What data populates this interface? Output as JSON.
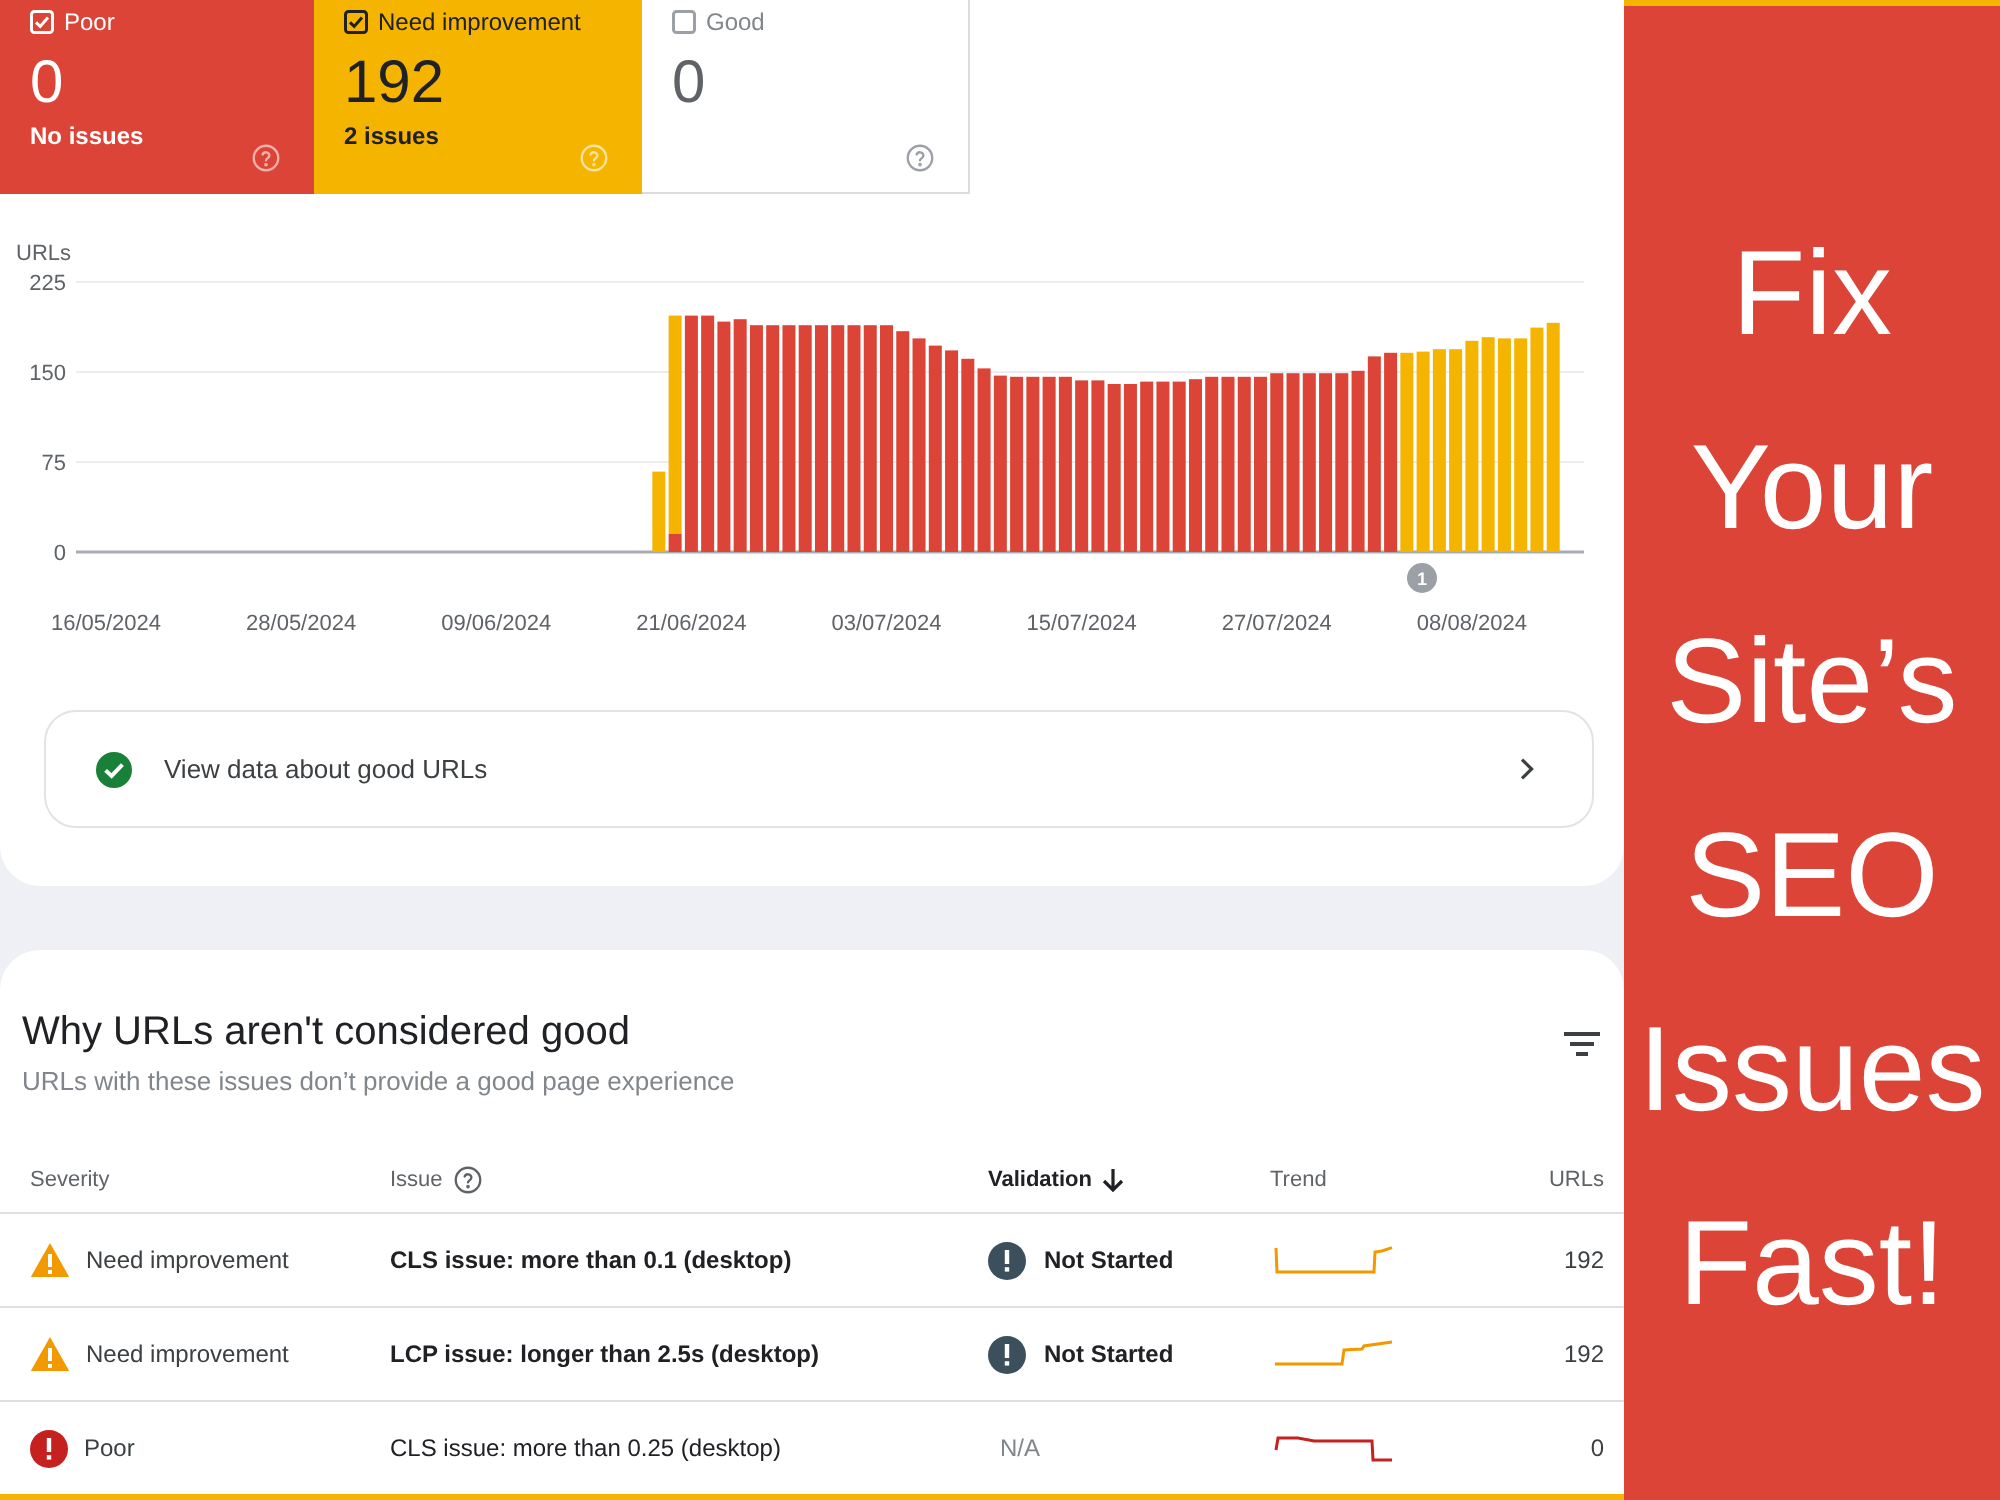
{
  "summary_cards": [
    {
      "label": "Poor",
      "checked": true,
      "color": "#db4437",
      "count": "0",
      "summary": "No issues"
    },
    {
      "label": "Need improvement",
      "checked": true,
      "color": "#f4b400",
      "count": "192",
      "summary": "2 issues"
    },
    {
      "label": "Good",
      "checked": false,
      "count": "0"
    }
  ],
  "chart": {
    "chart_data": {
      "type": "bar",
      "ylabel": "URLs",
      "categories": [
        "16/05/2024",
        null,
        null,
        null,
        null,
        null,
        null,
        null,
        null,
        null,
        null,
        null,
        "28/05/2024",
        null,
        null,
        null,
        null,
        null,
        null,
        null,
        null,
        null,
        null,
        null,
        "09/06/2024",
        null,
        null,
        null,
        null,
        null,
        null,
        null,
        null,
        null,
        null,
        null,
        "21/06/2024",
        null,
        null,
        null,
        null,
        null,
        null,
        null,
        null,
        null,
        null,
        null,
        "03/07/2024",
        null,
        null,
        null,
        null,
        null,
        null,
        null,
        null,
        null,
        null,
        null,
        "15/07/2024",
        null,
        null,
        null,
        null,
        null,
        null,
        null,
        null,
        null,
        null,
        null,
        "27/07/2024",
        null,
        null,
        null,
        null,
        null,
        null,
        null,
        null,
        null,
        null,
        null,
        "08/08/2024",
        null,
        null,
        null,
        null,
        null
      ],
      "series": [
        {
          "color": "#db4437",
          "values": [
            null,
            null,
            null,
            null,
            null,
            null,
            null,
            null,
            null,
            null,
            null,
            null,
            null,
            null,
            null,
            null,
            null,
            null,
            null,
            null,
            null,
            null,
            null,
            null,
            null,
            null,
            null,
            null,
            null,
            null,
            null,
            null,
            null,
            null,
            null,
            15,
            197,
            197,
            192,
            194,
            189,
            189,
            189,
            189,
            189,
            189,
            189,
            189,
            189,
            184,
            178,
            172,
            168,
            161,
            153,
            147,
            146,
            146,
            146,
            146,
            143,
            143,
            140,
            140,
            142,
            142,
            142,
            144,
            146,
            146,
            146,
            146,
            149,
            149,
            149,
            149,
            149,
            151,
            163,
            166,
            null,
            null,
            null,
            null,
            null,
            null,
            null,
            null,
            null,
            null
          ]
        },
        {
          "color": "#f4b400",
          "values": [
            null,
            null,
            null,
            null,
            null,
            null,
            null,
            null,
            null,
            null,
            null,
            null,
            null,
            null,
            null,
            null,
            null,
            null,
            null,
            null,
            null,
            null,
            null,
            null,
            null,
            null,
            null,
            null,
            null,
            null,
            null,
            null,
            null,
            null,
            67,
            182,
            null,
            null,
            null,
            null,
            null,
            null,
            null,
            null,
            null,
            null,
            null,
            null,
            null,
            null,
            null,
            null,
            null,
            null,
            null,
            null,
            null,
            null,
            null,
            null,
            null,
            null,
            null,
            null,
            null,
            null,
            null,
            null,
            null,
            null,
            null,
            null,
            null,
            null,
            null,
            null,
            null,
            null,
            null,
            null,
            166,
            167,
            169,
            169,
            176,
            179,
            178,
            178,
            187,
            191
          ]
        }
      ],
      "ylim": [
        0,
        225
      ],
      "yticks": [
        0,
        75,
        150,
        225
      ],
      "stacked": true,
      "annotations": [
        "1"
      ]
    }
  },
  "good_urls_link": {
    "label": "View data about good URLs"
  },
  "issues": {
    "title": "Why URLs aren't considered good",
    "subtitle": "URLs with these issues don’t provide a good page experience",
    "columns": [
      {
        "label": "Severity",
        "help": false,
        "sorted": false
      },
      {
        "label": "Issue",
        "help": true,
        "sorted": false
      },
      {
        "label": "Validation",
        "help": false,
        "sorted": true
      },
      {
        "label": "Trend",
        "help": false,
        "sorted": false
      },
      {
        "label": "URLs",
        "help": false,
        "sorted": false
      }
    ],
    "rows": [
      {
        "severity": {
          "label": "Need improvement",
          "kind": "warning"
        },
        "issue": "CLS issue: more than 0.1 (desktop)",
        "emphasized": true,
        "validation": {
          "label": "Not Started",
          "kind": "pending"
        },
        "urls": "192"
      },
      {
        "severity": {
          "label": "Need improvement",
          "kind": "warning"
        },
        "issue": "LCP issue: longer than 2.5s (desktop)",
        "emphasized": true,
        "validation": {
          "label": "Not Started",
          "kind": "pending"
        },
        "urls": "192"
      },
      {
        "severity": {
          "label": "Poor",
          "kind": "error"
        },
        "issue": "CLS issue: more than 0.25 (desktop)",
        "emphasized": false,
        "validation": {
          "label": "N/A",
          "kind": "none"
        },
        "urls": "0"
      }
    ]
  },
  "banner": {
    "title": "Fix Your Site’s SEO Issues Fast!"
  }
}
